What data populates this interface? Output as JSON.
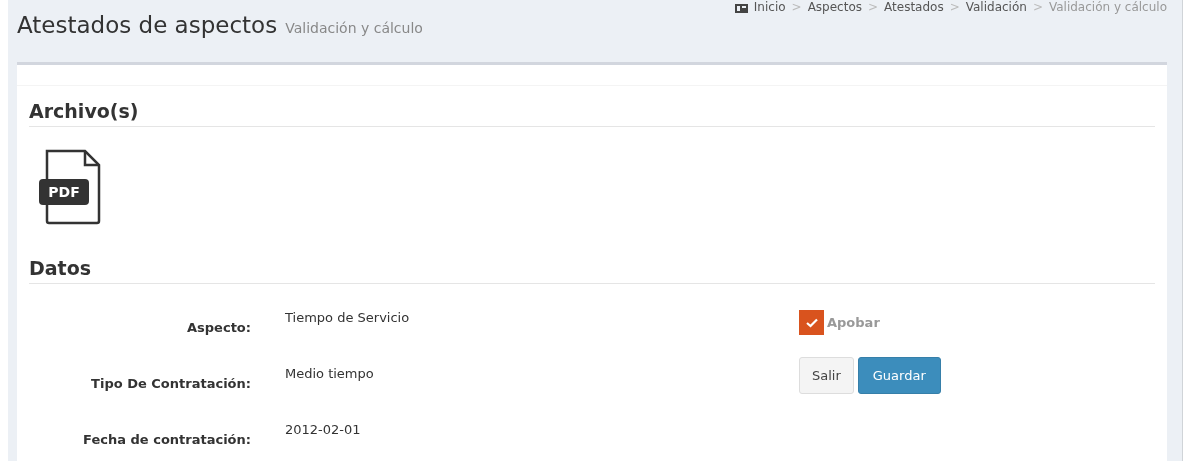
{
  "header": {
    "title": "Atestados de aspectos",
    "subtitle": "Validación y cálculo"
  },
  "breadcrumb": [
    {
      "label": "Inicio",
      "active": false
    },
    {
      "label": "Aspectos",
      "active": false
    },
    {
      "label": "Atestados",
      "active": false
    },
    {
      "label": "Validación",
      "active": false
    },
    {
      "label": "Validación y cálculo",
      "active": true
    }
  ],
  "breadcrumb_separator": ">",
  "files": {
    "heading": "Archivo(s)",
    "items": [
      {
        "kind": "pdf",
        "label": "PDF"
      }
    ]
  },
  "data": {
    "heading": "Datos",
    "fields": [
      {
        "label": "Aspecto:",
        "value": "Tiempo de Servicio"
      },
      {
        "label": "Tipo De Contratación:",
        "value": "Medio tiempo"
      },
      {
        "label": "Fecha de contratación:",
        "value": "2012-02-01"
      }
    ]
  },
  "approve": {
    "label": "Apobar",
    "checked": true
  },
  "buttons": [
    {
      "label": "Salir",
      "kind": "default"
    },
    {
      "label": "Guardar",
      "kind": "primary"
    }
  ]
}
